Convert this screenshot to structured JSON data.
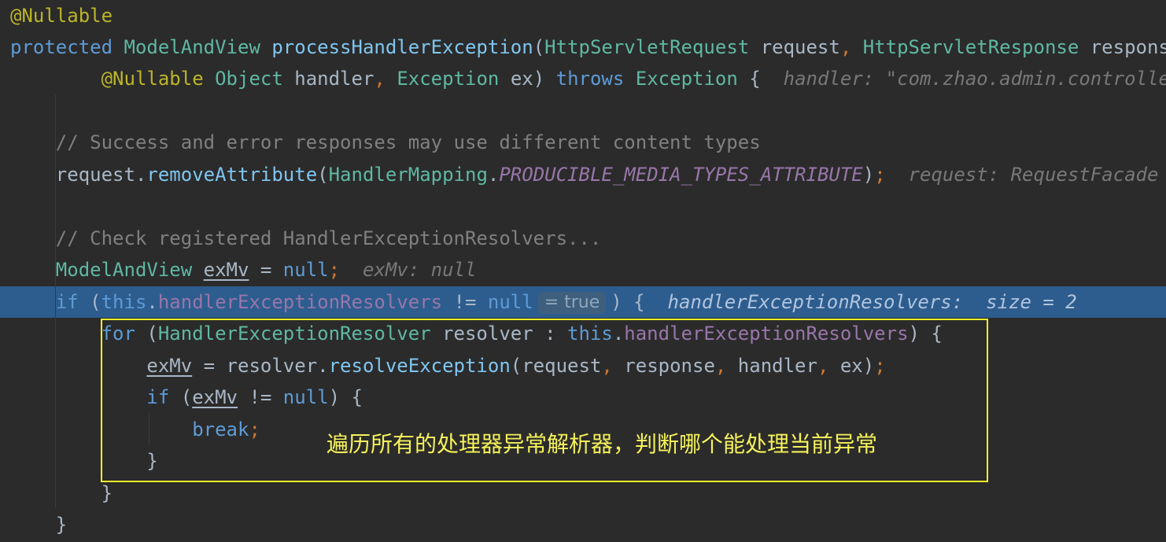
{
  "code": {
    "lines": [
      [
        {
          "t": "@Nullable",
          "c": "ann"
        }
      ],
      [
        {
          "t": "protected ",
          "c": "kwb"
        },
        {
          "t": "ModelAndView ",
          "c": "type"
        },
        {
          "t": "processHandlerException",
          "c": "fn"
        },
        {
          "t": "(",
          "c": "plain"
        },
        {
          "t": "HttpServletRequest ",
          "c": "type"
        },
        {
          "t": "request",
          "c": "plain"
        },
        {
          "t": ", ",
          "c": "punct"
        },
        {
          "t": "HttpServletResponse ",
          "c": "type"
        },
        {
          "t": "response",
          "c": "plain"
        }
      ],
      [
        {
          "t": "        ",
          "c": "plain"
        },
        {
          "t": "@Nullable ",
          "c": "ann"
        },
        {
          "t": "Object ",
          "c": "type"
        },
        {
          "t": "handler",
          "c": "plain"
        },
        {
          "t": ", ",
          "c": "punct"
        },
        {
          "t": "Exception ",
          "c": "type"
        },
        {
          "t": "ex",
          "c": "plain"
        },
        {
          "t": ") ",
          "c": "plain"
        },
        {
          "t": "throws ",
          "c": "kwb"
        },
        {
          "t": "Exception ",
          "c": "type"
        },
        {
          "t": "{  ",
          "c": "plain"
        },
        {
          "t": "handler: \"com.zhao.admin.controller",
          "c": "hint"
        }
      ],
      [],
      [
        {
          "t": "    ",
          "c": "plain"
        },
        {
          "t": "// Success and error responses may use different content types",
          "c": "cmt"
        }
      ],
      [
        {
          "t": "    ",
          "c": "plain"
        },
        {
          "t": "request",
          "c": "plain"
        },
        {
          "t": ".",
          "c": "plain"
        },
        {
          "t": "removeAttribute",
          "c": "fn"
        },
        {
          "t": "(",
          "c": "plain"
        },
        {
          "t": "HandlerMapping",
          "c": "type"
        },
        {
          "t": ".",
          "c": "plain"
        },
        {
          "t": "PRODUCIBLE_MEDIA_TYPES_ATTRIBUTE",
          "c": "constf"
        },
        {
          "t": ")",
          "c": "plain"
        },
        {
          "t": ";  ",
          "c": "punct"
        },
        {
          "t": "request: RequestFacade",
          "c": "hint"
        }
      ],
      [],
      [
        {
          "t": "    ",
          "c": "plain"
        },
        {
          "t": "// Check registered HandlerExceptionResolvers...",
          "c": "cmt"
        }
      ],
      [
        {
          "t": "    ",
          "c": "plain"
        },
        {
          "t": "ModelAndView ",
          "c": "type"
        },
        {
          "t": "exMv",
          "c": "plain ul"
        },
        {
          "t": " = ",
          "c": "plain"
        },
        {
          "t": "null",
          "c": "kwb"
        },
        {
          "t": ";  ",
          "c": "punct"
        },
        {
          "t": "exMv: null",
          "c": "hint"
        }
      ],
      [
        {
          "t": "    ",
          "c": "plain"
        },
        {
          "t": "if ",
          "c": "kwb"
        },
        {
          "t": "(",
          "c": "plain"
        },
        {
          "t": "this",
          "c": "kwb"
        },
        {
          "t": ".",
          "c": "plain"
        },
        {
          "t": "handlerExceptionResolvers",
          "c": "field"
        },
        {
          "t": " != ",
          "c": "plain"
        },
        {
          "t": "null",
          "c": "kwb"
        },
        {
          "badge": "= true"
        },
        {
          "t": ") {  ",
          "c": "plain"
        },
        {
          "t": "handlerExceptionResolvers:  size = 2",
          "c": "hint"
        }
      ],
      [
        {
          "t": "        ",
          "c": "plain"
        },
        {
          "t": "for ",
          "c": "kwb"
        },
        {
          "t": "(",
          "c": "plain"
        },
        {
          "t": "HandlerExceptionResolver ",
          "c": "type"
        },
        {
          "t": "resolver : ",
          "c": "plain"
        },
        {
          "t": "this",
          "c": "kwb"
        },
        {
          "t": ".",
          "c": "plain"
        },
        {
          "t": "handlerExceptionResolvers",
          "c": "field"
        },
        {
          "t": ") {",
          "c": "plain"
        }
      ],
      [
        {
          "t": "            ",
          "c": "plain"
        },
        {
          "t": "exMv",
          "c": "plain ul"
        },
        {
          "t": " = ",
          "c": "plain"
        },
        {
          "t": "resolver",
          "c": "plain"
        },
        {
          "t": ".",
          "c": "plain"
        },
        {
          "t": "resolveException",
          "c": "fn"
        },
        {
          "t": "(",
          "c": "plain"
        },
        {
          "t": "request",
          "c": "plain"
        },
        {
          "t": ", ",
          "c": "punct"
        },
        {
          "t": "response",
          "c": "plain"
        },
        {
          "t": ", ",
          "c": "punct"
        },
        {
          "t": "handler",
          "c": "plain"
        },
        {
          "t": ", ",
          "c": "punct"
        },
        {
          "t": "ex",
          "c": "plain"
        },
        {
          "t": ")",
          "c": "plain"
        },
        {
          "t": ";",
          "c": "punct"
        }
      ],
      [
        {
          "t": "            ",
          "c": "plain"
        },
        {
          "t": "if ",
          "c": "kwb"
        },
        {
          "t": "(",
          "c": "plain"
        },
        {
          "t": "exMv",
          "c": "plain ul"
        },
        {
          "t": " != ",
          "c": "plain"
        },
        {
          "t": "null",
          "c": "kwb"
        },
        {
          "t": ") {",
          "c": "plain"
        }
      ],
      [
        {
          "t": "                ",
          "c": "plain"
        },
        {
          "t": "break",
          "c": "kwb"
        },
        {
          "t": ";",
          "c": "punct"
        }
      ],
      [
        {
          "t": "            ",
          "c": "plain"
        },
        {
          "t": "}",
          "c": "plain"
        }
      ],
      [
        {
          "t": "        ",
          "c": "plain"
        },
        {
          "t": "}",
          "c": "plain"
        }
      ],
      [
        {
          "t": "    ",
          "c": "plain"
        },
        {
          "t": "}",
          "c": "plain"
        }
      ]
    ]
  },
  "annotation": {
    "text": "遍历所有的处理器异常解析器，判断哪个能处理当前异常",
    "box_color": "#f2f02a"
  },
  "colors": {
    "background": "#2b2b2b",
    "execution_line": "#2d5d8e"
  }
}
